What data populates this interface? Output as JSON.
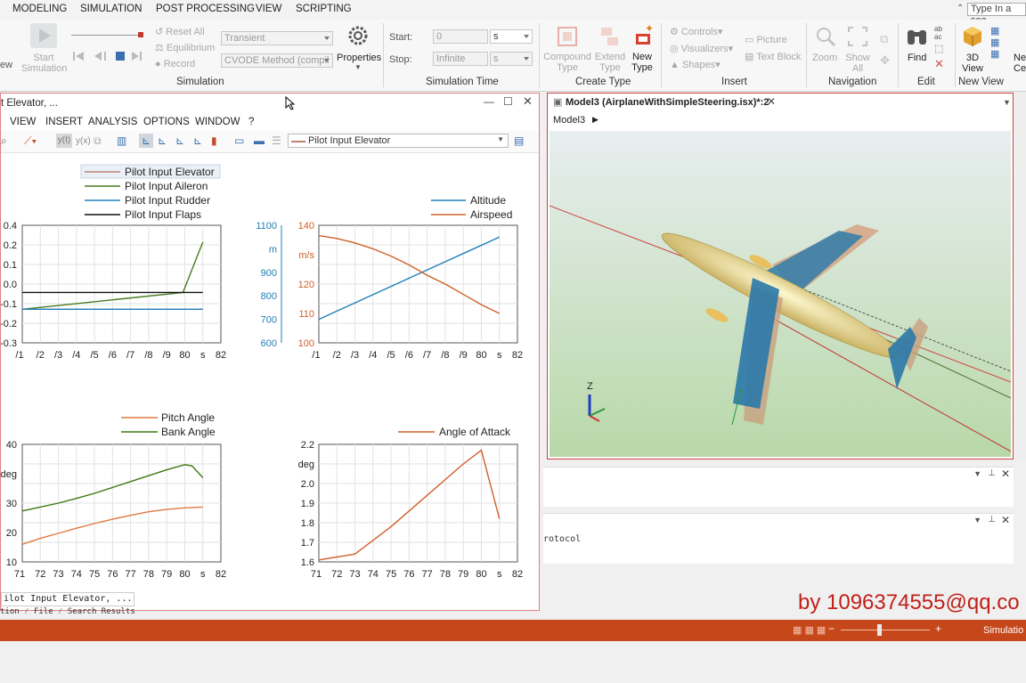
{
  "menubar": {
    "items": [
      "MODELING",
      "SIMULATION",
      "POST PROCESSING",
      "VIEW",
      "SCRIPTING"
    ],
    "search_placeholder": "Type In a sea"
  },
  "ribbon": {
    "simulation": {
      "start_label": "Start Simulation",
      "reset_all": "Reset All",
      "equilibrium": "Equilibrium",
      "record": "Record",
      "mode": "Transient",
      "method": "CVODE Method (compil",
      "properties": "Properties",
      "group": "Simulation"
    },
    "time": {
      "start_label": "Start:",
      "start_value": "0",
      "start_unit": "s",
      "stop_label": "Stop:",
      "stop_value": "Infinite",
      "stop_unit": "s",
      "group": "Simulation Time"
    },
    "create_type": {
      "compound": "Compound Type",
      "extend": "Extend Type",
      "new": "New Type",
      "group": "Create Type"
    },
    "insert": {
      "controls": "Controls",
      "visualizers": "Visualizers",
      "shapes": "Shapes",
      "picture": "Picture",
      "textblock": "Text Block",
      "group": "Insert"
    },
    "navigation": {
      "zoom": "Zoom",
      "show_all": "Show All",
      "group": "Navigation"
    },
    "edit": {
      "find": "Find",
      "group": "Edit"
    },
    "newview": {
      "view3d": "3D View",
      "cen": "Ne Cen",
      "group": "New View"
    }
  },
  "plotwin": {
    "title": "t Elevator, ...",
    "menus": [
      "VIEW",
      "INSERT",
      "ANALYSIS",
      "OPTIONS",
      "WINDOW",
      "?"
    ],
    "combo_value": "Pilot Input Elevator",
    "bottom_tab": "ilot Input Elevator, ...",
    "bottom_tabs2": [
      "tion",
      "File",
      "Search Results"
    ]
  },
  "modelwin": {
    "title": "Model3 (AirplaneWithSimpleSteering.isx)*:2",
    "breadcrumb": "Model3",
    "axis_label": "Z"
  },
  "panes": {
    "protocol": "rotocol"
  },
  "status": {
    "text": "Simulatio"
  },
  "watermark": "by 1096374555@qq.co",
  "colors": {
    "elevator": "#c08070",
    "aileron": "#4a7a20",
    "rudder": "#2080c0",
    "flaps": "#111111",
    "altitude": "#1f7fb8",
    "airspeed": "#d0602a",
    "pitch": "#e07a40",
    "bank": "#3a7a10",
    "aoa": "#d0602a"
  },
  "chart_data": [
    {
      "type": "line",
      "title": "",
      "x_tick_labels": [
        "/1",
        "/2",
        "/3",
        "/4",
        "/5",
        "/6",
        "/7",
        "/8",
        "/9",
        "80",
        "s",
        "82"
      ],
      "y_tick_labels": [
        "0.4",
        "0.2",
        "0.1",
        "0.0",
        "-0.1",
        "-0.2",
        "-0.3"
      ],
      "ylim": [
        -0.3,
        0.4
      ],
      "xlim": [
        71,
        82
      ],
      "series": [
        {
          "name": "Pilot Input Elevator",
          "x": [
            71,
            81
          ],
          "y": [
            -0.1,
            -0.1
          ]
        },
        {
          "name": "Pilot Input Aileron",
          "x": [
            71,
            79.9,
            81
          ],
          "y": [
            -0.1,
            0.0,
            0.3
          ]
        },
        {
          "name": "Pilot Input Rudder",
          "x": [
            71,
            81
          ],
          "y": [
            -0.1,
            -0.1
          ]
        },
        {
          "name": "Pilot Input Flaps",
          "x": [
            71,
            81
          ],
          "y": [
            0.0,
            0.0
          ]
        }
      ]
    },
    {
      "type": "line",
      "title": "",
      "x_tick_labels": [
        "/1",
        "/2",
        "/3",
        "/4",
        "/5",
        "/6",
        "/7",
        "/8",
        "/9",
        "80",
        "s",
        "82"
      ],
      "y_tick_labels_left": [
        "1100",
        "m",
        "900",
        "800",
        "700",
        "600"
      ],
      "y_tick_labels_right": [
        "140",
        "m/s",
        "120",
        "110",
        "100"
      ],
      "xlim": [
        71,
        82
      ],
      "ylim_left": [
        600,
        1100
      ],
      "ylim_right": [
        100,
        140
      ],
      "series": [
        {
          "name": "Altitude",
          "axis": "left",
          "x": [
            71,
            73,
            75,
            77,
            79,
            81
          ],
          "y": [
            700,
            770,
            840,
            910,
            980,
            1050
          ]
        },
        {
          "name": "Airspeed",
          "axis": "right",
          "x": [
            71,
            72,
            73,
            74,
            75,
            76,
            77,
            78,
            79,
            80,
            81
          ],
          "y": [
            136.5,
            135.5,
            134,
            132,
            129.5,
            126.5,
            123,
            120,
            116.5,
            113,
            110
          ]
        }
      ]
    },
    {
      "type": "line",
      "title": "",
      "x_tick_labels": [
        "71",
        "72",
        "73",
        "74",
        "75",
        "76",
        "77",
        "78",
        "79",
        "80",
        "s",
        "82"
      ],
      "y_tick_labels": [
        "40",
        "deg",
        "30",
        "20",
        "10"
      ],
      "ylim": [
        10,
        40
      ],
      "xlim": [
        71,
        82
      ],
      "series": [
        {
          "name": "Pitch Angle",
          "x": [
            71,
            72,
            73,
            74,
            75,
            76,
            77,
            78,
            79,
            80,
            81
          ],
          "y": [
            14.5,
            16,
            17.3,
            18.6,
            19.8,
            20.9,
            21.9,
            22.8,
            23.4,
            23.8,
            24
          ]
        },
        {
          "name": "Bank Angle",
          "x": [
            71,
            72,
            73,
            74,
            75,
            76,
            77,
            78,
            79,
            80,
            80.4,
            81
          ],
          "y": [
            23,
            24,
            25,
            26.2,
            27.5,
            29,
            30.5,
            32,
            33.5,
            34.8,
            34.5,
            31.5
          ]
        }
      ]
    },
    {
      "type": "line",
      "title": "",
      "x_tick_labels": [
        "71",
        "72",
        "73",
        "74",
        "75",
        "76",
        "77",
        "78",
        "79",
        "80",
        "s",
        "82"
      ],
      "y_tick_labels": [
        "2.2",
        "deg",
        "2.0",
        "1.9",
        "1.8",
        "1.7",
        "1.6"
      ],
      "ylim": [
        1.6,
        2.2
      ],
      "xlim": [
        71,
        82
      ],
      "series": [
        {
          "name": "Angle of Attack",
          "x": [
            71,
            72,
            73,
            74,
            75,
            76,
            77,
            78,
            79,
            80,
            81
          ],
          "y": [
            1.61,
            1.625,
            1.64,
            1.71,
            1.78,
            1.86,
            1.94,
            2.02,
            2.1,
            2.17,
            1.82
          ]
        }
      ]
    }
  ]
}
